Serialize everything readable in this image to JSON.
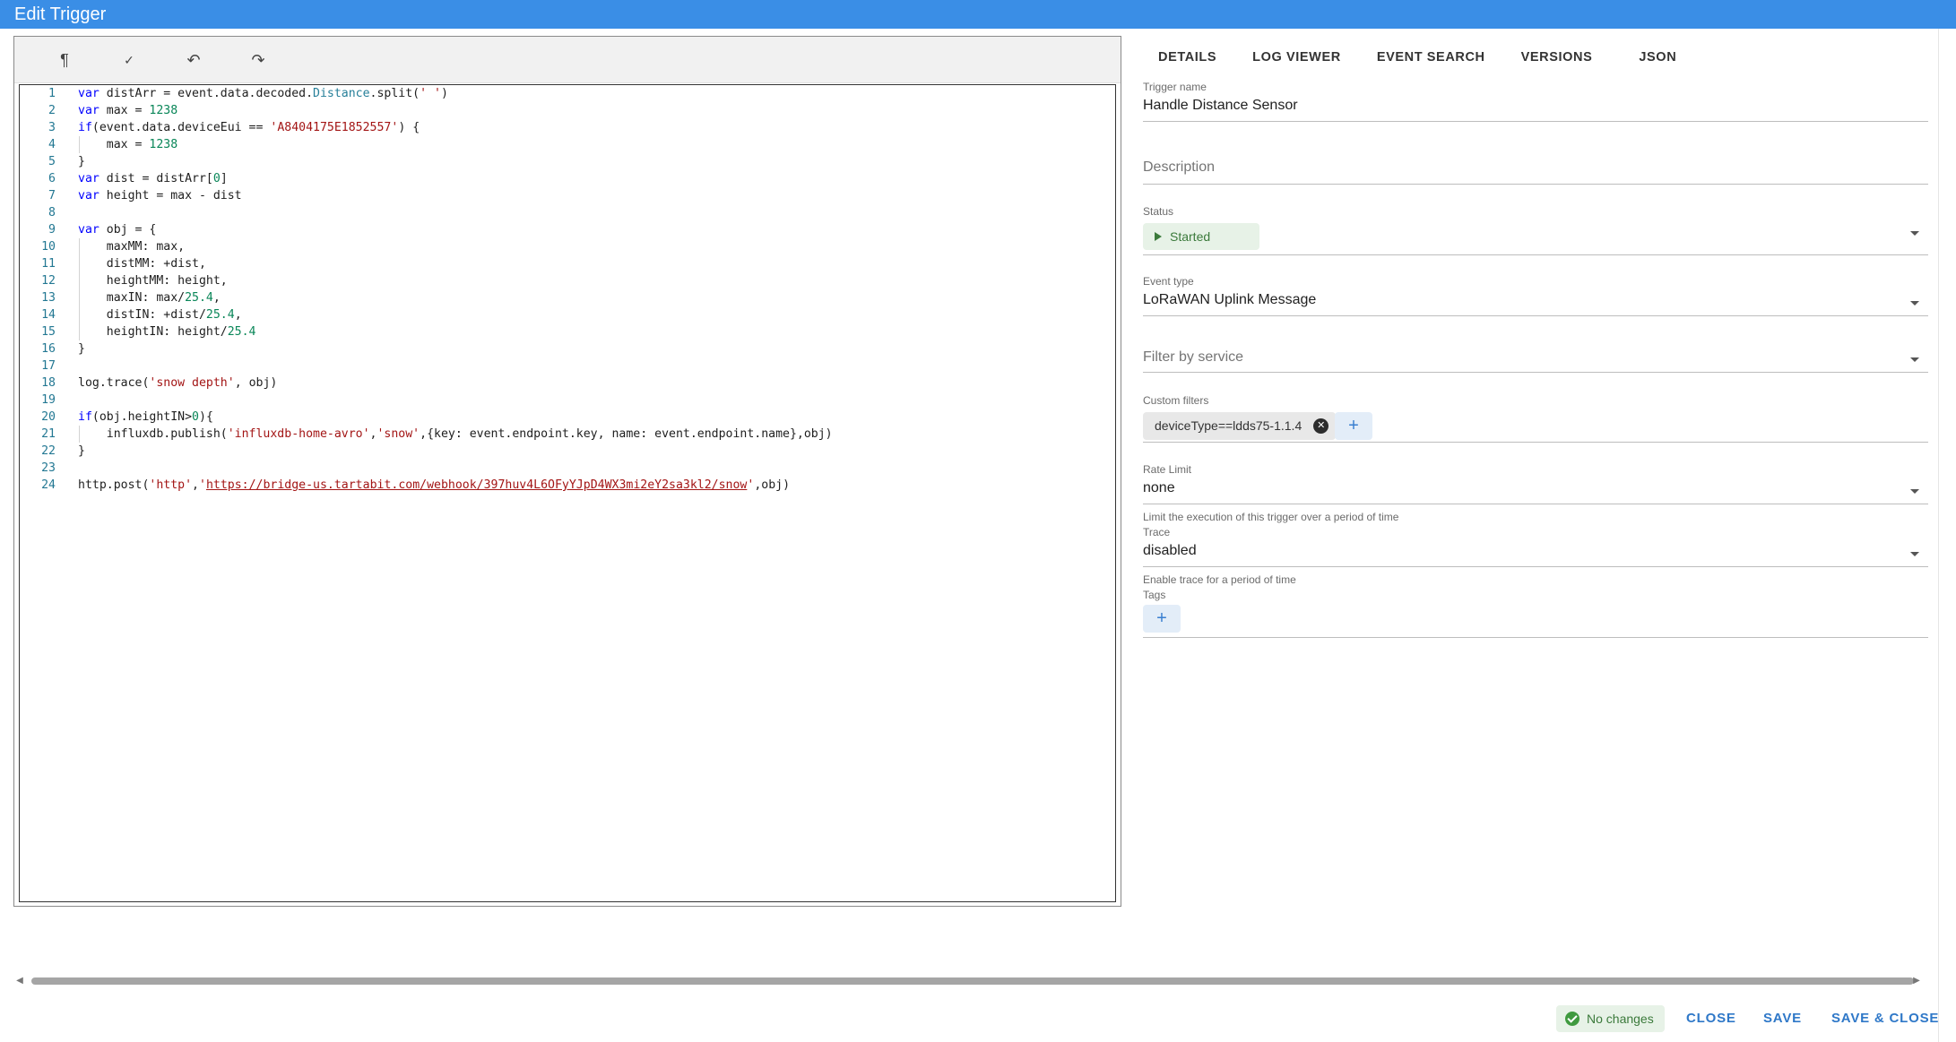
{
  "window": {
    "title": "Edit Trigger"
  },
  "toolbar": {
    "items": [
      {
        "icon": "pilcrow-icon",
        "glyph": "¶"
      },
      {
        "icon": "format-check-icon",
        "glyph": "✓"
      },
      {
        "icon": "undo-icon",
        "glyph": "↶"
      },
      {
        "icon": "redo-icon",
        "glyph": "↷"
      }
    ]
  },
  "code": {
    "lines": [
      "var distArr = event.data.decoded.Distance.split(' ')",
      "var max = 1238",
      "if(event.data.deviceEui == 'A8404175E1852557') {",
      "    max = 1238",
      "}",
      "var dist = distArr[0]",
      "var height = max - dist",
      "",
      "var obj = {",
      "    maxMM: max,",
      "    distMM: +dist,",
      "    heightMM: height,",
      "    maxIN: max/25.4,",
      "    distIN: +dist/25.4,",
      "    heightIN: height/25.4",
      "}",
      "",
      "log.trace('snow depth', obj)",
      "",
      "if(obj.heightIN>0){",
      "    influxdb.publish('influxdb-home-avro','snow',{key: event.endpoint.key, name: event.endpoint.name},obj)",
      "}",
      "",
      "http.post('http','https://bridge-us.tartabit.com/webhook/397huv4L6OFyYJpD4WX3mi2eY2sa3kl2/snow',obj)"
    ]
  },
  "tabs": [
    {
      "label": "DETAILS",
      "active": true
    },
    {
      "label": "LOG VIEWER"
    },
    {
      "label": "EVENT SEARCH"
    },
    {
      "label": "VERSIONS"
    },
    {
      "label": "JSON"
    }
  ],
  "form": {
    "trigger_name": {
      "label": "Trigger name",
      "value": "Handle Distance Sensor"
    },
    "description": {
      "placeholder": "Description"
    },
    "status": {
      "label": "Status",
      "value": "Started"
    },
    "event_type": {
      "label": "Event type",
      "value": "LoRaWAN Uplink Message"
    },
    "filter_service": {
      "placeholder": "Filter by service"
    },
    "custom_filters": {
      "label": "Custom filters",
      "chips": [
        "deviceType==ldds75-1.1.4"
      ]
    },
    "rate_limit": {
      "label": "Rate Limit",
      "value": "none",
      "hint": "Limit the execution of this trigger over a period of time"
    },
    "trace": {
      "label": "Trace",
      "value": "disabled",
      "hint": "Enable trace for a period of time"
    },
    "tags": {
      "label": "Tags"
    }
  },
  "footer": {
    "status": "No changes",
    "close": "CLOSE",
    "save": "SAVE",
    "save_close": "SAVE & CLOSE"
  },
  "colors": {
    "accent": "#3a8ee6",
    "success": "#3b7a3b"
  }
}
